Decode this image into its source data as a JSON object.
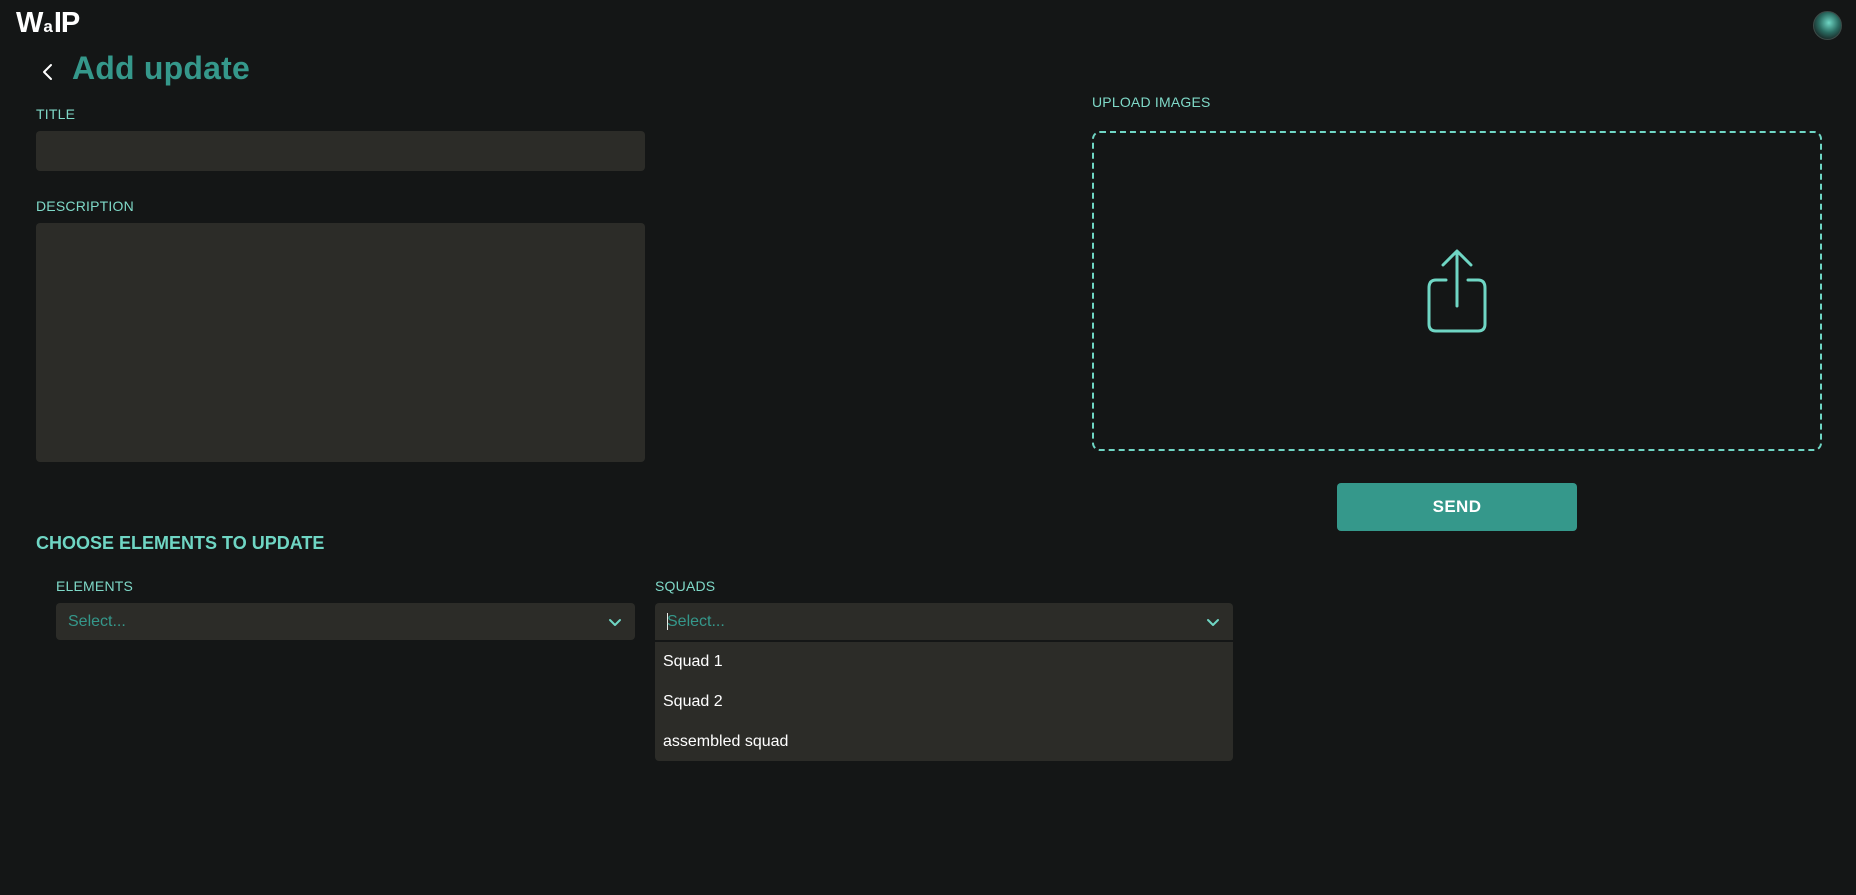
{
  "app": {
    "logo": {
      "left": "W",
      "mid": "a",
      "right": "IP"
    }
  },
  "header": {
    "title": "Add update"
  },
  "form": {
    "title_label": "TITLE",
    "title_value": "",
    "description_label": "DESCRIPTION",
    "description_value": "",
    "upload_label": "UPLOAD IMAGES",
    "send_label": "SEND"
  },
  "elements_section": {
    "heading": "CHOOSE ELEMENTS TO UPDATE",
    "elements": {
      "label": "ELEMENTS",
      "placeholder": "Select..."
    },
    "squads": {
      "label": "SQUADS",
      "placeholder": "Select...",
      "options": [
        "Squad 1",
        "Squad 2",
        "assembled squad"
      ]
    }
  },
  "icons": {
    "back": "chevron-left-icon",
    "upload": "share-upload-icon",
    "dropdown": "chevron-down-icon"
  },
  "colors": {
    "background": "#141616",
    "accent": "#35988b",
    "accent_light": "#6fd6c4",
    "field_bg": "#2c2c28"
  }
}
